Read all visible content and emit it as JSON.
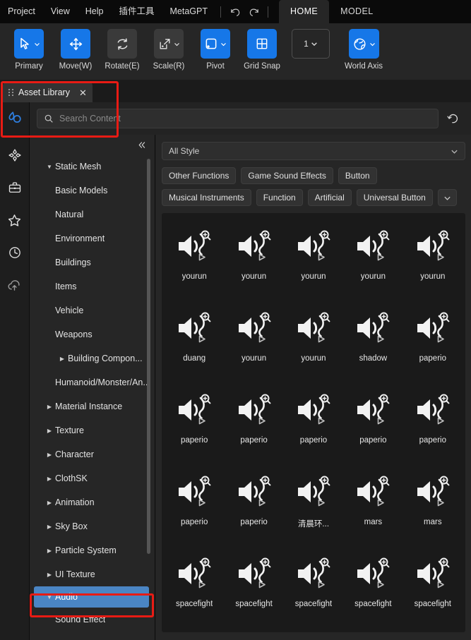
{
  "menubar": {
    "items": [
      "Project",
      "View",
      "Help",
      "插件工具",
      "MetaGPT"
    ],
    "undo_icon": "undo-icon",
    "redo_icon": "redo-icon",
    "tabs": [
      {
        "label": "HOME",
        "active": true
      },
      {
        "label": "MODEL",
        "active": false
      }
    ]
  },
  "ribbon": {
    "tools": [
      {
        "label": "Primary",
        "icon": "cursor-arrow-icon",
        "state": "on",
        "caret": true
      },
      {
        "label": "Move(W)",
        "icon": "move-arrows-icon",
        "state": "on",
        "caret": false
      },
      {
        "label": "Rotate(E)",
        "icon": "rotate-icon",
        "state": "off",
        "caret": false
      },
      {
        "label": "Scale(R)",
        "icon": "scale-icon",
        "state": "off",
        "caret": true
      },
      {
        "label": "Pivot",
        "icon": "pivot-icon",
        "state": "on",
        "caret": true
      },
      {
        "label": "Grid Snap",
        "icon": "grid-icon",
        "state": "on",
        "caret": false
      },
      {
        "label": "",
        "icon": "grid-size-value",
        "state": "outline",
        "caret": true,
        "value": "1"
      },
      {
        "label": "World Axis",
        "icon": "globe-icon",
        "state": "on",
        "caret": true
      }
    ]
  },
  "asset_library": {
    "tab_title": "Asset Library",
    "close_icon": "close-icon",
    "grip_icon": "drag-grip-icon",
    "logo_icon": "asset-library-logo-icon",
    "search": {
      "placeholder": "Search Content",
      "value": "",
      "icon": "search-icon"
    },
    "refresh_icon": "refresh-icon",
    "rail_icons": [
      "assets-diamond-icon",
      "briefcase-icon",
      "star-icon",
      "clock-history-icon",
      "cloud-upload-icon"
    ],
    "collapse_icon": "collapse-left-icon",
    "tree": [
      {
        "label": "Static Mesh",
        "twisty": "down",
        "indent": 0,
        "selected": false
      },
      {
        "label": "Basic Models",
        "twisty": "none",
        "indent": 0,
        "selected": false
      },
      {
        "label": "Natural",
        "twisty": "none",
        "indent": 0,
        "selected": false
      },
      {
        "label": "Environment",
        "twisty": "none",
        "indent": 0,
        "selected": false
      },
      {
        "label": "Buildings",
        "twisty": "none",
        "indent": 0,
        "selected": false
      },
      {
        "label": "Items",
        "twisty": "none",
        "indent": 0,
        "selected": false
      },
      {
        "label": "Vehicle",
        "twisty": "none",
        "indent": 0,
        "selected": false
      },
      {
        "label": "Weapons",
        "twisty": "none",
        "indent": 0,
        "selected": false
      },
      {
        "label": "Building Compon...",
        "twisty": "right",
        "indent": 1,
        "selected": false
      },
      {
        "label": "Humanoid/Monster/An...",
        "twisty": "none",
        "indent": 0,
        "selected": false
      },
      {
        "label": "Material Instance",
        "twisty": "right",
        "indent": 0,
        "selected": false
      },
      {
        "label": "Texture",
        "twisty": "right",
        "indent": 0,
        "selected": false
      },
      {
        "label": "Character",
        "twisty": "right",
        "indent": 0,
        "selected": false
      },
      {
        "label": "ClothSK",
        "twisty": "right",
        "indent": 0,
        "selected": false
      },
      {
        "label": "Animation",
        "twisty": "right",
        "indent": 0,
        "selected": false
      },
      {
        "label": "Sky Box",
        "twisty": "right",
        "indent": 0,
        "selected": false
      },
      {
        "label": "Particle System",
        "twisty": "right",
        "indent": 0,
        "selected": false
      },
      {
        "label": "UI Texture",
        "twisty": "right",
        "indent": 0,
        "selected": false
      },
      {
        "label": "Audio",
        "twisty": "down",
        "indent": 0,
        "selected": true
      },
      {
        "label": "Sound Effect",
        "twisty": "none",
        "indent": 0,
        "selected": false
      }
    ],
    "style_filter": {
      "value": "All Style",
      "caret_icon": "chevron-down-icon"
    },
    "chips": [
      "Other Functions",
      "Game Sound Effects",
      "Button",
      "Musical Instruments",
      "Function",
      "Artificial",
      "Universal Button"
    ],
    "chips_more_icon": "chevron-down-icon",
    "assets": [
      {
        "label": "yourun",
        "icon": "audio-speaker-icon"
      },
      {
        "label": "yourun",
        "icon": "audio-speaker-icon"
      },
      {
        "label": "yourun",
        "icon": "audio-speaker-icon"
      },
      {
        "label": "yourun",
        "icon": "audio-speaker-icon"
      },
      {
        "label": "yourun",
        "icon": "audio-speaker-icon"
      },
      {
        "label": "duang",
        "icon": "audio-speaker-icon"
      },
      {
        "label": "yourun",
        "icon": "audio-speaker-icon"
      },
      {
        "label": "yourun",
        "icon": "audio-speaker-icon"
      },
      {
        "label": "shadow",
        "icon": "audio-speaker-icon"
      },
      {
        "label": "paperio",
        "icon": "audio-speaker-icon"
      },
      {
        "label": "paperio",
        "icon": "audio-speaker-icon"
      },
      {
        "label": "paperio",
        "icon": "audio-speaker-icon"
      },
      {
        "label": "paperio",
        "icon": "audio-speaker-icon"
      },
      {
        "label": "paperio",
        "icon": "audio-speaker-icon"
      },
      {
        "label": "paperio",
        "icon": "audio-speaker-icon"
      },
      {
        "label": "paperio",
        "icon": "audio-speaker-icon"
      },
      {
        "label": "paperio",
        "icon": "audio-speaker-icon"
      },
      {
        "label": "清晨环...",
        "icon": "audio-speaker-icon"
      },
      {
        "label": "mars",
        "icon": "audio-speaker-icon"
      },
      {
        "label": "mars",
        "icon": "audio-speaker-icon"
      },
      {
        "label": "spacefight",
        "icon": "audio-speaker-icon"
      },
      {
        "label": "spacefight",
        "icon": "audio-speaker-icon"
      },
      {
        "label": "spacefight",
        "icon": "audio-speaker-icon"
      },
      {
        "label": "spacefight",
        "icon": "audio-speaker-icon"
      },
      {
        "label": "spacefight",
        "icon": "audio-speaker-icon"
      }
    ]
  },
  "annotations": {
    "highlight_color": "#e81b14",
    "boxes": [
      "asset-library-panel-header",
      "audio-tree-node"
    ]
  },
  "colors": {
    "accent_blue": "#1677e8",
    "selection_blue": "#4a85c4",
    "menubar_bg": "#0a0a0a",
    "ribbon_bg": "#262626",
    "panel_bg": "#232323",
    "grid_bg": "#1a1a1a"
  }
}
